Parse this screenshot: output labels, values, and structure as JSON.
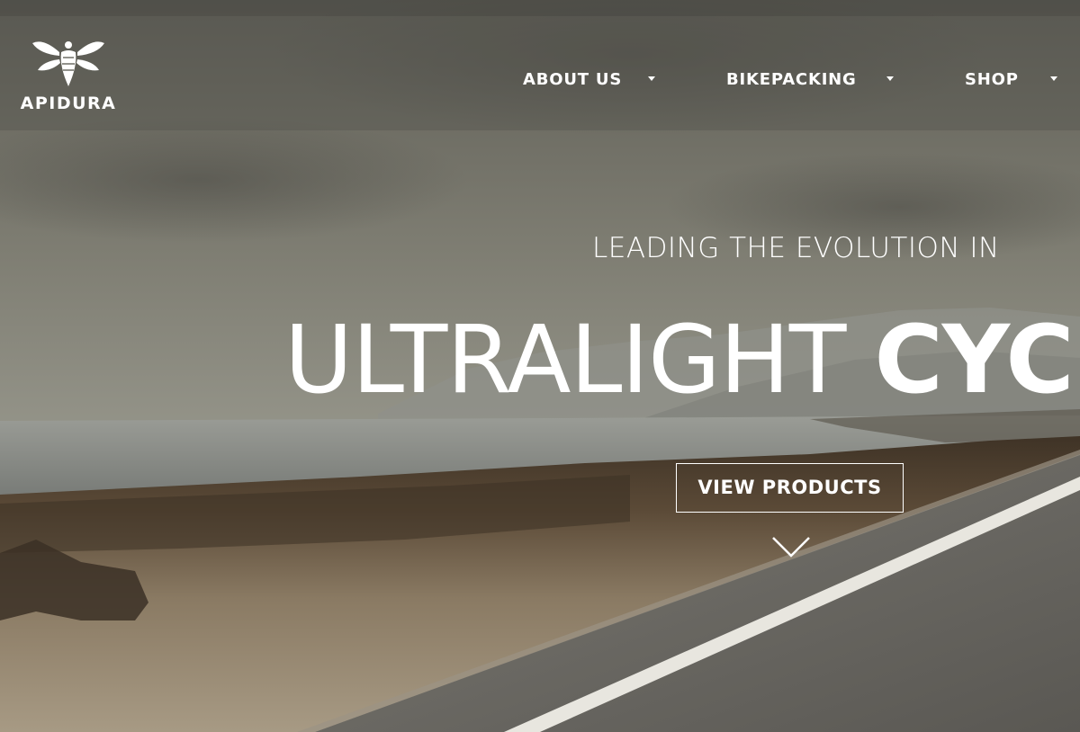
{
  "brand": {
    "name": "APIDURA",
    "logo_icon": "bee-icon"
  },
  "nav": {
    "items": [
      {
        "label": "ABOUT US",
        "icon": "caret-down-icon"
      },
      {
        "label": "BIKEPACKING",
        "icon": "caret-down-icon"
      },
      {
        "label": "SHOP",
        "icon": "caret-down-icon"
      }
    ]
  },
  "hero": {
    "tagline": "LEADING THE EVOLUTION IN",
    "headline_light": "ULTRALIGHT ",
    "headline_bold": "CYCLING",
    "cta_label": "VIEW PRODUCTS",
    "scroll_icon": "chevron-down-icon",
    "background": "coastal-road-photo"
  },
  "colors": {
    "text": "#ffffff",
    "sky": "#8a897d",
    "sea": "#7d817e",
    "earth": "#5a4a36",
    "road": "#6a6862"
  }
}
